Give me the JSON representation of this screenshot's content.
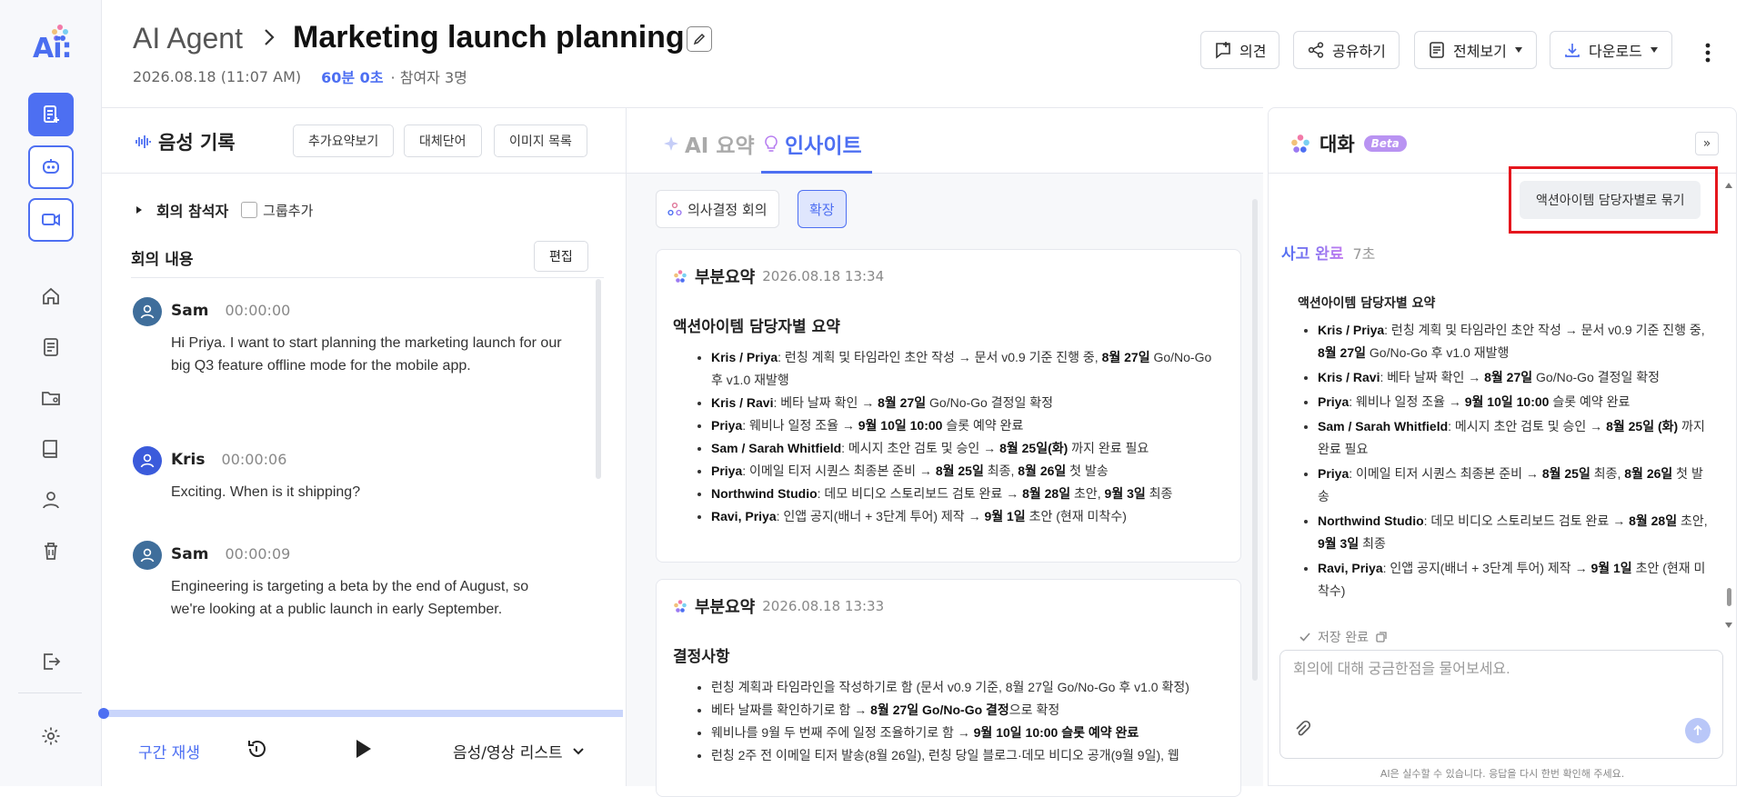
{
  "app": {
    "logo_text": "Ai:",
    "brand_color": "#4d6ff2",
    "rail_icons": [
      "new-note-icon",
      "ai-bot-icon",
      "screen-record-icon",
      "home-icon",
      "document-icon",
      "shared-folder-icon",
      "book-icon",
      "user-icon",
      "trash-icon",
      "logout-icon",
      "settings-icon"
    ]
  },
  "header": {
    "breadcrumb_parent": "AI Agent",
    "title": "Marketing launch planning",
    "date": "2026.08.18 (11:07 AM)",
    "duration": "60분 0초",
    "participants": "· 참여자 3명",
    "buttons": {
      "opinion": "의견",
      "share": "공유하기",
      "view_all": "전체보기",
      "download": "다운로드"
    }
  },
  "voice": {
    "title": "음성 기록",
    "buttons": {
      "extra_summary": "추가요약보기",
      "replace_words": "대체단어",
      "image_list": "이미지 목록"
    },
    "participants_label": "회의 참석자",
    "group_add": "그룹추가",
    "contents_label": "회의 내용",
    "edit": "편집",
    "utterances": [
      {
        "speaker": "Sam",
        "time": "00:00:00",
        "text": "Hi Priya. I want to start planning the marketing launch for our big Q3 feature offline mode for the mobile app.",
        "color": "#3f6e9b"
      },
      {
        "speaker": "Kris",
        "time": "00:00:06",
        "text": "Exciting. When is it shipping?",
        "color": "#3b5bdb"
      },
      {
        "speaker": "Sam",
        "time": "00:00:09",
        "text": "Engineering is targeting a beta by the end of August, so we're looking at a public launch in early September.",
        "color": "#3f6e9b"
      }
    ],
    "player": {
      "segment_play": "구간 재생",
      "media_list": "음성/영상 리스트",
      "progress": 0.0
    }
  },
  "insights": {
    "tabs": {
      "ai_summary": "AI 요약",
      "insight": "인사이트"
    },
    "chips": {
      "decision_meeting": "의사결정 회의",
      "expand": "확장"
    },
    "cards": [
      {
        "label": "부분요약",
        "time": "2026.08.18 13:34",
        "subtitle": "액션아이템 담당자별 요약",
        "items": [
          {
            "who": "Kris / Priya",
            "pre": ": 런칭 계획 및 타임라인 초안 작성 → 문서 v0.9 기준 진행 중, ",
            "b1": "8월 27일",
            "mid": " Go/No-Go 후 v1.0 재발행",
            "b2": "",
            "post": ""
          },
          {
            "who": "Kris / Ravi",
            "pre": ": 베타 날짜 확인 → ",
            "b1": "8월 27일",
            "mid": " Go/No-Go 결정일 확정",
            "b2": "",
            "post": ""
          },
          {
            "who": "Priya",
            "pre": ": 웨비나 일정 조율 → ",
            "b1": "9월 10일 10:00",
            "mid": " 슬롯 예약 완료",
            "b2": "",
            "post": ""
          },
          {
            "who": "Sam / Sarah Whitfield",
            "pre": ": 메시지 초안 검토 및 승인 → ",
            "b1": "8월 25일(화)",
            "mid": " 까지 완료 필요",
            "b2": "",
            "post": ""
          },
          {
            "who": "Priya",
            "pre": ": 이메일 티저 시퀀스 최종본 준비 → ",
            "b1": "8월 25일",
            "mid": " 최종, ",
            "b2": "8월 26일",
            "post": " 첫 발송"
          },
          {
            "who": "Northwind Studio",
            "pre": ": 데모 비디오 스토리보드 검토 완료 → ",
            "b1": "8월 28일",
            "mid": " 초안, ",
            "b2": "9월 3일",
            "post": " 최종"
          },
          {
            "who": "Ravi, Priya",
            "pre": ": 인앱 공지(배너 + 3단계 투어) 제작 → ",
            "b1": "9월 1일",
            "mid": " 초안 (현재 미착수)",
            "b2": "",
            "post": ""
          }
        ]
      },
      {
        "label": "부분요약",
        "time": "2026.08.18 13:33",
        "subtitle": "결정사항",
        "items": [
          {
            "who": "",
            "pre": "런칭 계획과 타임라인을 작성하기로 함 (문서 v0.9 기준, 8월 27일 Go/No-Go 후 v1.0 확정)",
            "b1": "",
            "mid": "",
            "b2": "",
            "post": ""
          },
          {
            "who": "",
            "pre": "베타 날짜를 확인하기로 함 → ",
            "b1": "8월 27일 Go/No-Go 결정",
            "mid": "으로 확정",
            "b2": "",
            "post": ""
          },
          {
            "who": "",
            "pre": "웨비나를 9월 두 번째 주에 일정 조율하기로 함 → ",
            "b1": "9월 10일 10:00 슬롯 예약 완료",
            "mid": "",
            "b2": "",
            "post": ""
          },
          {
            "who": "",
            "pre": "런칭 2주 전 이메일 티저 발송(8월 26일), 런칭 당일 블로그·데모 비디오 공개(9월 9일), 웹",
            "b1": "",
            "mid": "",
            "b2": "",
            "post": ""
          }
        ]
      }
    ]
  },
  "chat": {
    "title": "대화",
    "beta": "Beta",
    "collapse": "»",
    "suggestion": "액션아이템 담당자별로 묶기",
    "thinking_label": "사고 완료",
    "thinking_time": "7초",
    "answer_title": "액션아이템 담당자별 요약",
    "answer_items": [
      {
        "who": "Kris / Priya",
        "pre": ": 런칭 계획 및 타임라인 초안 작성 → 문서 v0.9 기준 진행 중, ",
        "b1": "8월 27일",
        "mid": " Go/No-Go 후 v1.0 재발행",
        "b2": "",
        "post": ""
      },
      {
        "who": "Kris / Ravi",
        "pre": ": 베타 날짜 확인 → ",
        "b1": "8월 27일",
        "mid": " Go/No-Go 결정일 확정",
        "b2": "",
        "post": ""
      },
      {
        "who": "Priya",
        "pre": ": 웨비나 일정 조율 → ",
        "b1": "9월 10일 10:00",
        "mid": " 슬롯 예약 완료",
        "b2": "",
        "post": ""
      },
      {
        "who": "Sam / Sarah Whitfield",
        "pre": ": 메시지 초안 검토 및 승인 → ",
        "b1": "8월 25일 (화)",
        "mid": " 까지 완료 필요",
        "b2": "",
        "post": ""
      },
      {
        "who": "Priya",
        "pre": ": 이메일 티저 시퀀스 최종본 준비 → ",
        "b1": "8월 25일",
        "mid": " 최종, ",
        "b2": "8월 26일",
        "post": " 첫 발송"
      },
      {
        "who": "Northwind Studio",
        "pre": ": 데모 비디오 스토리보드 검토 완료 → ",
        "b1": "8월 28일",
        "mid": " 초안, ",
        "b2": "9월 3일",
        "post": " 최종"
      },
      {
        "who": "Ravi, Priya",
        "pre": ": 인앱 공지(배너 + 3단계 투어) 제작 → ",
        "b1": "9월 1일",
        "mid": " 초안 (현재 미착수)",
        "b2": "",
        "post": ""
      }
    ],
    "saved_label": "저장 완료",
    "input_placeholder": "회의에 대해 궁금한점을 물어보세요.",
    "disclaimer": "AI은 실수할 수 있습니다. 응답을 다시 한번 확인해 주세요."
  }
}
